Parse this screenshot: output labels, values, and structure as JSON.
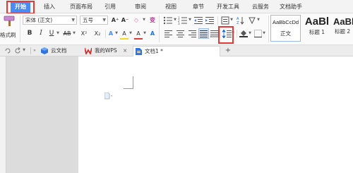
{
  "menu": {
    "items": [
      "开始",
      "插入",
      "页面布局",
      "引用",
      "审阅",
      "视图",
      "章节",
      "开发工具",
      "云服务",
      "文档助手"
    ]
  },
  "ribbon": {
    "format_painter_label": "格式刷",
    "font_name": "宋体 (正文)",
    "font_size": "五号",
    "grow_font": "A⁺",
    "shrink_font": "A⁻",
    "clear_format": "◇",
    "bold": "B",
    "italic": "I",
    "underline": "U",
    "strikethrough": "AB",
    "superscript": "X²",
    "subscript": "X₂",
    "font_color_a": "A",
    "highlight_a": "A",
    "text_effect_a": "A",
    "styles": [
      {
        "sample": "AaBbCcDd",
        "name": "正文"
      },
      {
        "sample": "AaBl",
        "name": "标题 1"
      },
      {
        "sample": "AaBb",
        "name": "标题 2"
      }
    ]
  },
  "tabs": {
    "items": [
      {
        "label": "云文档"
      },
      {
        "label": "我的WPS"
      },
      {
        "label": "文档1 *"
      }
    ],
    "new_tab": "+"
  },
  "colors": {
    "accent": "#4a8af4",
    "highlight_red": "#e53935",
    "wps_red": "#d32f2f",
    "font_yellow": "#f9d71c"
  }
}
